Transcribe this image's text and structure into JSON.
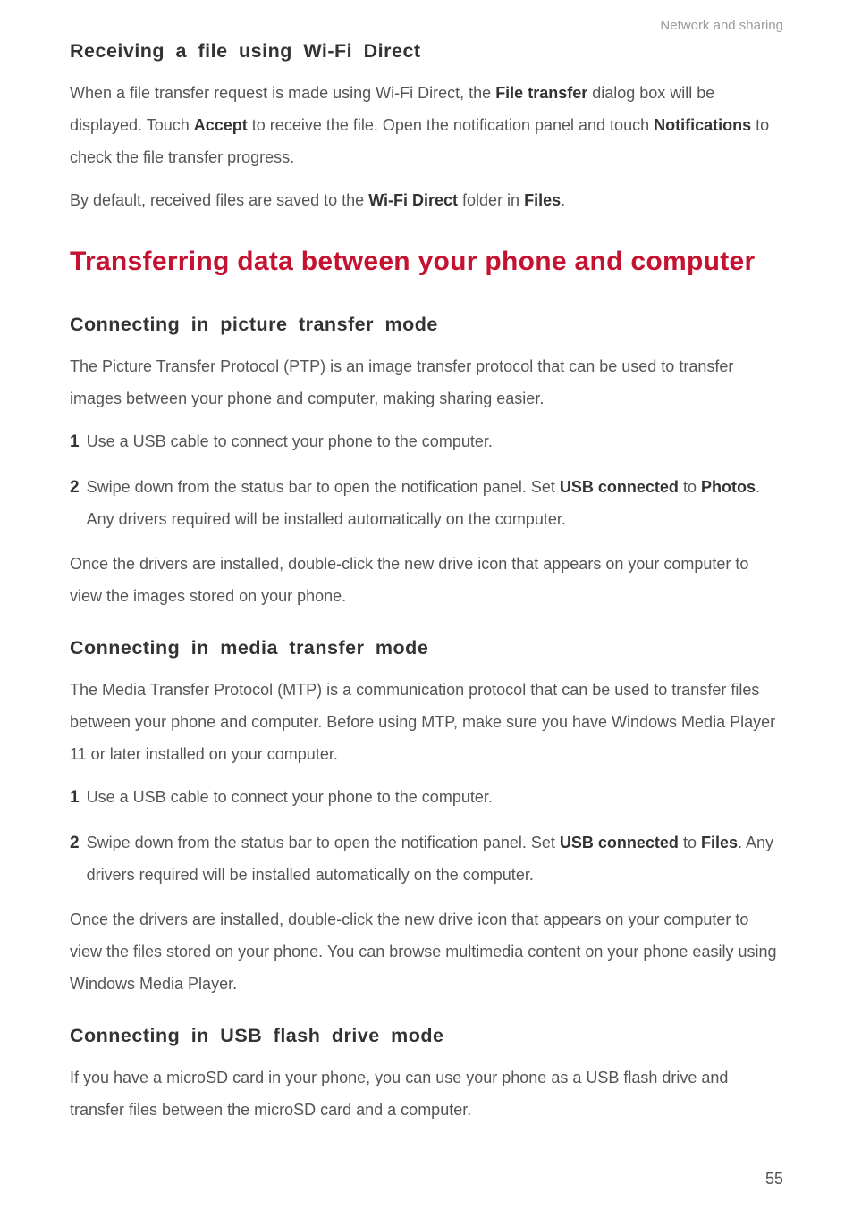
{
  "header": {
    "section": "Network and sharing"
  },
  "s1": {
    "title": "Receiving a file using Wi-Fi Direct",
    "p1_a": "When a file transfer request is made using Wi-Fi Direct, the ",
    "p1_b1": "File transfer",
    "p1_c": " dialog box will be displayed. Touch ",
    "p1_b2": "Accept",
    "p1_d": " to receive the file. Open the notification panel and touch ",
    "p1_b3": "Notifications",
    "p1_e": " to check the file transfer progress.",
    "p2_a": "By default, received files are saved to the ",
    "p2_b1": "Wi-Fi Direct",
    "p2_c": " folder in ",
    "p2_b2": "Files",
    "p2_d": "."
  },
  "h1": "Transferring data between your phone and computer",
  "s2": {
    "title": "Connecting in picture transfer mode",
    "intro": "The Picture Transfer Protocol (PTP) is an image transfer protocol that can be used to transfer images between your phone and computer, making sharing easier.",
    "step1_num": "1",
    "step1": "Use a USB cable to connect your phone to the computer.",
    "step2_num": "2",
    "step2_a": "Swipe down from the status bar to open the notification panel. Set ",
    "step2_b1": "USB connected",
    "step2_c": " to ",
    "step2_b2": "Photos",
    "step2_d": ". Any drivers required will be installed automatically on the computer.",
    "outro": "Once the drivers are installed, double-click the new drive icon that appears on your computer to view the images stored on your phone."
  },
  "s3": {
    "title": "Connecting in media transfer mode",
    "intro": "The Media Transfer Protocol (MTP) is a communication protocol that can be used to transfer files between your phone and computer. Before using MTP, make sure you have Windows Media Player 11 or later installed on your computer.",
    "step1_num": "1",
    "step1": "Use a USB cable to connect your phone to the computer.",
    "step2_num": "2",
    "step2_a": "Swipe down from the status bar to open the notification panel. Set ",
    "step2_b1": "USB connected",
    "step2_c": " to ",
    "step2_b2": "Files",
    "step2_d": ". Any drivers required will be installed automatically on the computer.",
    "outro": "Once the drivers are installed, double-click the new drive icon that appears on your computer to view the files stored on your phone. You can browse multimedia content on your phone easily using Windows Media Player."
  },
  "s4": {
    "title": "Connecting in USB flash drive mode",
    "intro": "If you have a microSD card in your phone, you can use your phone as a USB flash drive and transfer files between the microSD card and a computer."
  },
  "pageNumber": "55"
}
